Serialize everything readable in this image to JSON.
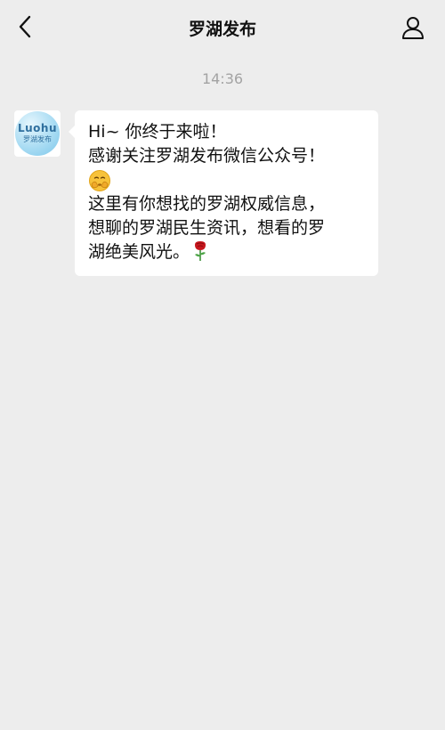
{
  "header": {
    "title": "罗湖发布",
    "back_icon": "chevron-left-icon",
    "profile_icon": "person-icon"
  },
  "chat": {
    "timestamp": "14:36",
    "message": {
      "sender_avatar": {
        "logo_text": "Luohu",
        "subtitle": "罗湖发布"
      },
      "lines": [
        "Hi~ 你终于来啦！",
        "感谢关注罗湖发布微信公众号！",
        "这里有你想找的罗湖权威信息，",
        "想聊的罗湖民生资讯，想看的罗",
        "湖绝美风光。"
      ],
      "emoji_after_line_2": "shy-hands-emoji",
      "emoji_end": "rose-icon"
    }
  },
  "colors": {
    "background": "#ededed",
    "bubble": "#ffffff",
    "timestamp": "#a3a3a3"
  }
}
